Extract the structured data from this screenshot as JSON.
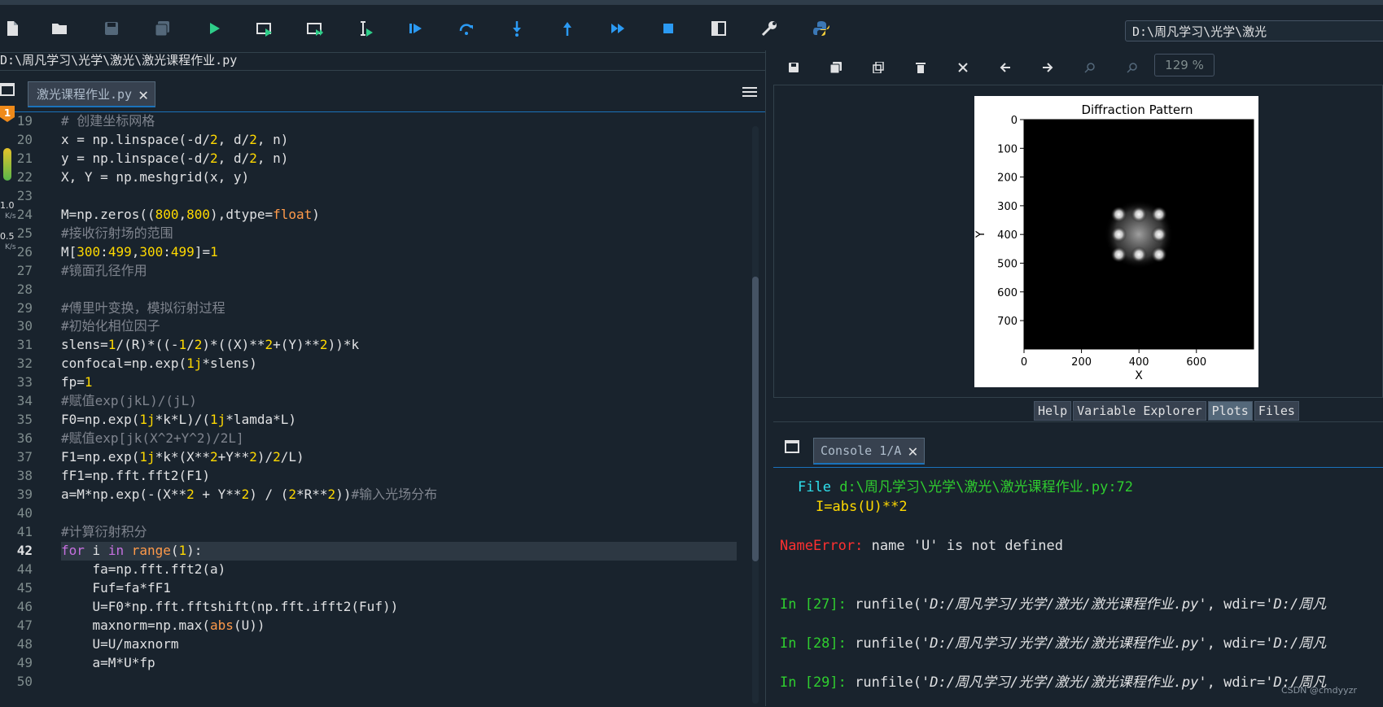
{
  "toolbar": {
    "path": "D:\\周凡学习\\光学\\激光",
    "icons": [
      "new-file-icon",
      "open-folder-icon",
      "save-icon",
      "save-all-icon",
      "run-icon",
      "run-cell-icon",
      "run-cell-advance-icon",
      "run-selection-icon",
      "debug-icon",
      "step-icon",
      "step-into-icon",
      "step-out-icon",
      "continue-icon",
      "stop-icon",
      "maximize-pane-icon",
      "wrench-icon",
      "python-icon"
    ]
  },
  "editor": {
    "file_path": "D:\\周凡学习\\光学\\激光\\激光课程作业.py",
    "tab_label": "激光课程作业.py",
    "current_line": "42",
    "side": {
      "val1": "1.0",
      "unit1": "K/s",
      "val2": "0.5",
      "unit2": "K/s",
      "badge": "1"
    },
    "line_numbers": [
      "19",
      "20",
      "21",
      "22",
      "23",
      "24",
      "25",
      "26",
      "27",
      "28",
      "29",
      "30",
      "31",
      "32",
      "33",
      "34",
      "35",
      "36",
      "37",
      "38",
      "39",
      "40",
      "41",
      "42",
      "44",
      "45",
      "46",
      "47",
      "48",
      "49",
      "50"
    ],
    "lines": [
      "# 创建坐标网格",
      "x = np.linspace(-d/2, d/2, n)",
      "y = np.linspace(-d/2, d/2, n)",
      "X, Y = np.meshgrid(x, y)",
      "",
      "M=np.zeros((800,800),dtype=float)",
      "#接收衍射场的范围",
      "M[300:499,300:499]=1",
      "#镜面孔径作用",
      "",
      "#傅里叶变换，模拟衍射过程",
      "#初始化相位因子",
      "slens=1/(R)*((-1/2)*((X)**2+(Y)**2))*k",
      "confocal=np.exp(1j*slens)",
      "fp=1",
      "#赋值exp(jkL)/(jL)",
      "F0=np.exp(1j*k*L)/(1j*lamda*L)",
      "#赋值exp[jk(X^2+Y^2)/2L]",
      "F1=np.exp(1j*k*(X**2+Y**2)/2/L)",
      "fF1=np.fft.fft2(F1)",
      "a=M*np.exp(-(X**2 + Y**2) / (2*R**2))#输入光场分布",
      "",
      "#计算衍射积分",
      "for i in range(1):",
      "    fa=np.fft.fft2(a)",
      "    Fuf=fa*fF1",
      "    U=F0*np.fft.fftshift(np.fft.ifft2(Fuf))",
      "    maxnorm=np.max(abs(U))",
      "    U=U/maxnorm",
      "    a=M*U*fp",
      ""
    ]
  },
  "plots": {
    "zoom": "129 %",
    "title": "Diffraction Pattern",
    "xlabel": "X",
    "ylabel": "Y",
    "xticks": [
      "0",
      "200",
      "400",
      "600"
    ],
    "yticks": [
      "0",
      "100",
      "200",
      "300",
      "400",
      "500",
      "600",
      "700"
    ],
    "icons": [
      "save-plot-icon",
      "save-all-plots-icon",
      "copy-icon",
      "remove-plot-icon",
      "remove-all-icon",
      "previous-icon",
      "next-icon",
      "zoom-in-icon",
      "zoom-out-icon"
    ]
  },
  "chart_data": {
    "type": "heatmap",
    "title": "Diffraction Pattern",
    "xlabel": "X",
    "ylabel": "Y",
    "xlim": [
      0,
      799
    ],
    "ylim": [
      799,
      0
    ],
    "x_ticks": [
      0,
      200,
      400,
      600
    ],
    "y_ticks": [
      0,
      100,
      200,
      300,
      400,
      500,
      600,
      700
    ],
    "colormap": "gray",
    "bright_region": {
      "x_range": [
        300,
        499
      ],
      "y_range": [
        300,
        499
      ]
    },
    "bright_spots": [
      [
        330,
        330
      ],
      [
        400,
        330
      ],
      [
        470,
        330
      ],
      [
        330,
        400
      ],
      [
        470,
        400
      ],
      [
        330,
        470
      ],
      [
        400,
        470
      ],
      [
        470,
        470
      ]
    ],
    "grid": false
  },
  "pane_tabs": [
    "Help",
    "Variable Explorer",
    "Plots",
    "Files"
  ],
  "console": {
    "tab_label": "Console 1/A",
    "file_kw": "File",
    "file_path": "d:\\周凡学习\\光学\\激光\\激光课程作业.py:72",
    "code_line": "I=abs(U)**2",
    "error_name": "NameError:",
    "error_msg": "name 'U' is not defined",
    "prompts": [
      {
        "label": "In [27]:",
        "text": "runfile(",
        "arg": "'D:/周凡学习/光学/激光/激光课程作业.py'",
        "rest": ", wdir=",
        "wdir": "'D:/周凡"
      },
      {
        "label": "In [28]:",
        "text": "runfile(",
        "arg": "'D:/周凡学习/光学/激光/激光课程作业.py'",
        "rest": ", wdir=",
        "wdir": "'D:/周凡"
      },
      {
        "label": "In [29]:",
        "text": "runfile(",
        "arg": "'D:/周凡学习/光学/激光/激光课程作业.py'",
        "rest": ", wdir=",
        "wdir": "'D:/周凡"
      }
    ]
  },
  "watermark": "CSDN @cmdyyzr"
}
